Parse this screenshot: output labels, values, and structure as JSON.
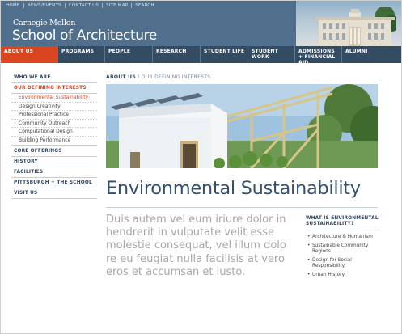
{
  "header": {
    "utility_links": [
      "HOME",
      "NEWS/EVENTS",
      "CONTACT US",
      "SITE MAP",
      "SEARCH"
    ],
    "brand_university": "Carnegie Mellon",
    "brand_school": "School of Architecture"
  },
  "nav": {
    "items": [
      {
        "label": "ABOUT US",
        "active": true
      },
      {
        "label": "PROGRAMS",
        "active": false
      },
      {
        "label": "PEOPLE",
        "active": false
      },
      {
        "label": "RESEARCH",
        "active": false
      },
      {
        "label": "STUDENT LIFE",
        "active": false
      },
      {
        "label": "STUDENT WORK",
        "active": false
      },
      {
        "label": "ADMISSIONS + FINANCIAL AID",
        "active": false
      },
      {
        "label": "ALUMNI",
        "active": false
      }
    ]
  },
  "sidebar": {
    "top": "WHO WE ARE",
    "section": "OUR DEFINING INTERESTS",
    "sub_items": [
      {
        "label": "Environmental Sustainability",
        "current": true
      },
      {
        "label": "Design Creativity",
        "current": false
      },
      {
        "label": "Professional Practice",
        "current": false
      },
      {
        "label": "Community Outreach",
        "current": false
      },
      {
        "label": "Computational Design",
        "current": false
      },
      {
        "label": "Building Performance",
        "current": false
      }
    ],
    "more": [
      "CORE OFFERINGS",
      "HISTORY",
      "FACILITIES",
      "PITTSBURGH + THE SCHOOL",
      "VISIT US"
    ]
  },
  "breadcrumb": {
    "first": "ABOUT US",
    "separator": " / ",
    "second": "OUR DEFINING INTERESTS"
  },
  "main": {
    "title": "Environmental Sustainability",
    "intro": "Duis autem vel eum iriure dolor in hendrerit in vulputate velit esse molestie consequat, vel illum dolo re eu feugiat nulla facilisis at vero eros et accumsan et iusto."
  },
  "aside": {
    "heading": "WHAT IS ENVIRONMENTAL SUSTAINABILITY?",
    "links": [
      "Architecture & Humanism",
      "Sustainable Community Regions",
      "Design for Social Responsibility",
      "Urban History"
    ]
  },
  "colors": {
    "header_blue": "#4f6f8c",
    "nav_navy": "#344b64",
    "accent_orange": "#d9451f",
    "title_blue": "#34506e",
    "intro_gray": "#a7a7a7"
  }
}
